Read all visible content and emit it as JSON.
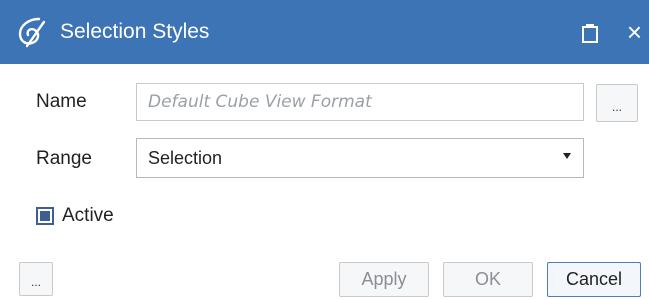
{
  "window": {
    "title": "Selection Styles",
    "logo_icon": "app-logo-icon",
    "restore_icon": "restore-icon",
    "close_icon": "close-icon",
    "close_glyph": "×",
    "title_bar_color": "#3d74b5"
  },
  "form": {
    "name": {
      "label": "Name",
      "value": "",
      "placeholder": "Default Cube View Format",
      "browse_label": "..."
    },
    "range": {
      "label": "Range",
      "selected": "Selection",
      "dropdown_icon": "dropdown-arrow-icon"
    },
    "active": {
      "label": "Active",
      "checked": true
    }
  },
  "footer": {
    "more_label": "...",
    "apply_label": "Apply",
    "ok_label": "OK",
    "cancel_label": "Cancel"
  }
}
